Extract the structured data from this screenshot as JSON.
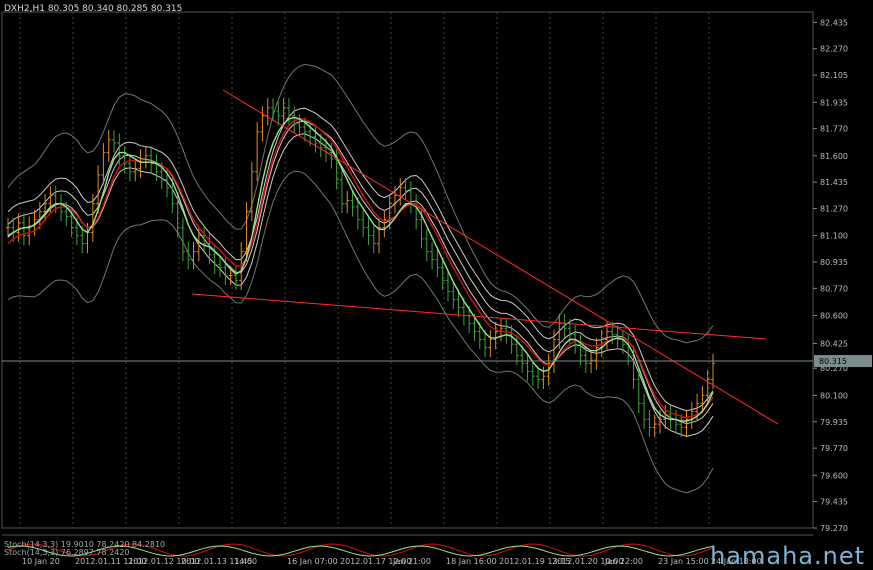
{
  "header": {
    "symbol": "DXH2,H1",
    "ohlc": "80.305 80.340 80.285 80.315"
  },
  "indicator_labels": [
    "Stoch(14,3,3) 19.9010 78.2420 84.2810",
    "Stoch(14,3,3) 76.2897 78.2420"
  ],
  "watermark": "hamaha.net",
  "current_price_label": "80.315",
  "colors": {
    "background": "#000000",
    "grid": "#3a4a3a",
    "bull": "#e08a2a",
    "bear": "#3da33d",
    "fast_ma": "#9be38a",
    "slow_ma": "#d01010",
    "envelope": "#f0f0f0",
    "band": "#6a7a6a",
    "trendline": "#ff2a2a"
  },
  "chart_data": {
    "type": "bar",
    "title": "",
    "ylim": [
      79.27,
      82.5
    ],
    "y_ticks": [
      "82.435",
      "82.270",
      "82.105",
      "81.935",
      "81.770",
      "81.600",
      "81.435",
      "81.270",
      "81.100",
      "80.935",
      "80.770",
      "80.600",
      "80.425",
      "80.270",
      "80.100",
      "79.935",
      "79.770",
      "79.600",
      "79.435",
      "79.270"
    ],
    "x_tick_labels": [
      "10 Jan 20",
      "2012.01.11 11:00",
      "2012.01.12 10:00",
      "2012.01.13 11:45",
      "14:00",
      "16 Jan 07:00",
      "2012.01.17 12:00",
      "Jan 21:00",
      "18 Jan 16:00",
      "2012.01.19 13:15",
      "2012.01.20 10:00",
      "Jan 22:00",
      "23 Jan 15:00",
      "24 Jan 18:00"
    ],
    "current_price": 80.315,
    "close": [
      81.15,
      81.12,
      81.18,
      81.1,
      81.16,
      81.2,
      81.25,
      81.3,
      81.35,
      81.3,
      81.25,
      81.22,
      81.15,
      81.1,
      81.05,
      81.12,
      81.3,
      81.48,
      81.62,
      81.7,
      81.68,
      81.6,
      81.55,
      81.5,
      81.52,
      81.58,
      81.6,
      81.55,
      81.5,
      81.45,
      81.4,
      81.3,
      81.15,
      81.0,
      80.95,
      81.0,
      81.1,
      81.05,
      80.98,
      80.92,
      80.9,
      80.85,
      80.85,
      80.82,
      81.0,
      81.25,
      81.5,
      81.75,
      81.85,
      81.9,
      81.88,
      81.85,
      81.9,
      81.85,
      81.8,
      81.78,
      81.75,
      81.72,
      81.68,
      81.65,
      81.62,
      81.58,
      81.45,
      81.3,
      81.32,
      81.28,
      81.2,
      81.15,
      81.1,
      81.05,
      81.15,
      81.2,
      81.3,
      81.35,
      81.4,
      81.38,
      81.3,
      81.2,
      81.08,
      81.0,
      80.95,
      80.9,
      80.82,
      80.75,
      80.7,
      80.65,
      80.6,
      80.55,
      80.5,
      80.45,
      80.4,
      80.45,
      80.5,
      80.52,
      80.48,
      80.42,
      80.35,
      80.3,
      80.25,
      80.22,
      80.2,
      80.22,
      80.3,
      80.45,
      80.55,
      80.52,
      80.48,
      80.42,
      80.35,
      80.3,
      80.32,
      80.4,
      80.45,
      80.5,
      80.48,
      80.45,
      80.42,
      80.35,
      80.2,
      80.05,
      79.95,
      79.9,
      79.92,
      79.95,
      79.98,
      79.95,
      79.92,
      79.9,
      79.95,
      80.0,
      80.05,
      80.1,
      80.2,
      80.3
    ],
    "fast_ma": [
      81.1,
      81.12,
      81.14,
      81.15,
      81.15,
      81.17,
      81.2,
      81.24,
      81.28,
      81.3,
      81.3,
      81.28,
      81.24,
      81.19,
      81.14,
      81.12,
      81.17,
      81.26,
      81.37,
      81.49,
      81.58,
      81.62,
      81.62,
      81.6,
      81.58,
      81.56,
      81.56,
      81.56,
      81.55,
      81.53,
      81.49,
      81.44,
      81.36,
      81.27,
      81.17,
      81.1,
      81.06,
      81.04,
      81.03,
      81.0,
      80.97,
      80.93,
      80.89,
      80.86,
      80.88,
      80.96,
      81.09,
      81.27,
      81.44,
      81.58,
      81.68,
      81.75,
      81.8,
      81.83,
      81.84,
      81.83,
      81.81,
      81.78,
      81.75,
      81.72,
      81.69,
      81.65,
      81.59,
      81.52,
      81.45,
      81.38,
      81.32,
      81.27,
      81.22,
      81.17,
      81.14,
      81.14,
      81.17,
      81.21,
      81.26,
      81.3,
      81.3,
      81.28,
      81.23,
      81.16,
      81.09,
      81.02,
      80.95,
      80.88,
      80.81,
      80.75,
      80.69,
      80.64,
      80.59,
      80.54,
      80.49,
      80.46,
      80.46,
      80.47,
      80.48,
      80.47,
      80.44,
      80.4,
      80.36,
      80.31,
      80.27,
      80.25,
      80.26,
      80.31,
      80.37,
      80.42,
      80.45,
      80.45,
      80.43,
      80.4,
      80.38,
      80.38,
      80.4,
      80.43,
      80.45,
      80.46,
      80.45,
      80.42,
      80.36,
      80.27,
      80.18,
      80.09,
      80.02,
      79.98,
      79.96,
      79.95,
      79.95,
      79.94,
      79.94,
      79.95,
      79.97,
      80.0,
      80.05,
      80.12
    ],
    "slow_ma": [
      81.05,
      81.08,
      81.1,
      81.11,
      81.12,
      81.13,
      81.16,
      81.2,
      81.24,
      81.27,
      81.28,
      81.28,
      81.26,
      81.23,
      81.18,
      81.15,
      81.16,
      81.21,
      81.29,
      81.38,
      81.47,
      81.53,
      81.56,
      81.57,
      81.57,
      81.56,
      81.56,
      81.56,
      81.55,
      81.54,
      81.52,
      81.48,
      81.42,
      81.35,
      81.27,
      81.2,
      81.15,
      81.11,
      81.07,
      81.04,
      81.01,
      80.97,
      80.94,
      80.91,
      80.91,
      80.96,
      81.05,
      81.17,
      81.32,
      81.46,
      81.58,
      81.67,
      81.74,
      81.79,
      81.82,
      81.83,
      81.83,
      81.81,
      81.79,
      81.76,
      81.73,
      81.7,
      81.65,
      81.59,
      81.53,
      81.47,
      81.41,
      81.35,
      81.3,
      81.25,
      81.21,
      81.19,
      81.2,
      81.22,
      81.25,
      81.28,
      81.3,
      81.3,
      81.27,
      81.22,
      81.16,
      81.1,
      81.03,
      80.96,
      80.9,
      80.84,
      80.78,
      80.72,
      80.67,
      80.62,
      80.57,
      80.53,
      80.51,
      80.5,
      80.5,
      80.49,
      80.47,
      80.44,
      80.41,
      80.37,
      80.33,
      80.3,
      80.29,
      80.31,
      80.35,
      80.39,
      80.42,
      80.44,
      80.44,
      80.42,
      80.41,
      80.41,
      80.42,
      80.44,
      80.45,
      80.46,
      80.46,
      80.44,
      80.4,
      80.33,
      80.25,
      80.17,
      80.1,
      80.05,
      80.01,
      79.99,
      79.98,
      79.97,
      79.96,
      79.97,
      79.98,
      80.0,
      80.04,
      80.09
    ]
  }
}
